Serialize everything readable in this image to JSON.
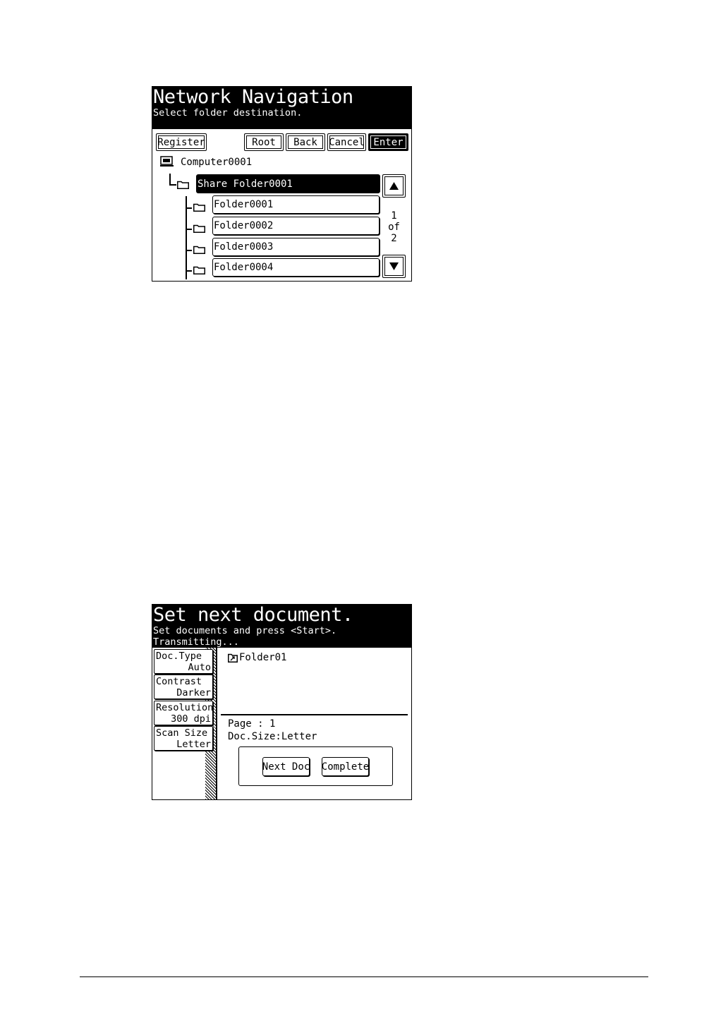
{
  "network_navigation": {
    "title": "Network Navigation",
    "subtitle": "Select folder destination.",
    "buttons": {
      "register": "Register",
      "root": "Root",
      "back": "Back",
      "cancel": "Cancel",
      "enter": "Enter"
    },
    "computer": "Computer0001",
    "share_folder": "Share Folder0001",
    "folders": [
      "Folder0001",
      "Folder0002",
      "Folder0003",
      "Folder0004"
    ],
    "pager": {
      "current": "1",
      "of": "of",
      "total": "2"
    }
  },
  "next_document": {
    "title": "Set next document.",
    "line1": "Set documents and press <Start>.",
    "line2": "Transmitting...",
    "settings": [
      {
        "label": "Doc.Type",
        "value": "Auto"
      },
      {
        "label": "Contrast",
        "value": "Darker"
      },
      {
        "label": "Resolution",
        "value": "300 dpi"
      },
      {
        "label": "Scan Size",
        "value": "Letter"
      }
    ],
    "destination": "Folder01",
    "page_line": "Page :  1",
    "docsize_line": "Doc.Size:Letter",
    "buttons": {
      "next_doc": "Next Doc",
      "complete": "Complete"
    }
  }
}
